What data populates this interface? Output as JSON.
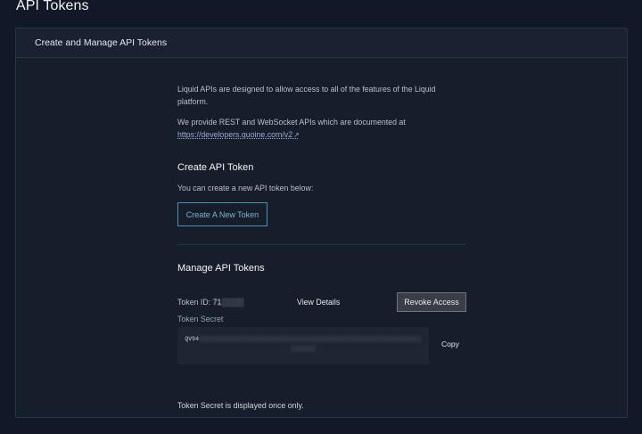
{
  "page": {
    "title": "API Tokens"
  },
  "card": {
    "header": "Create and Manage API Tokens"
  },
  "intro": {
    "line1": "Liquid APIs are designed to allow access to all of the features of the Liquid platform.",
    "line2_prefix": "We provide REST and WebSocket APIs which are documented at ",
    "link_text": "https://developers.quoine.com/v2",
    "link_icon": "external-link-icon"
  },
  "create": {
    "title": "Create API Token",
    "description": "You can create a new API token below:",
    "button_label": "Create A New Token"
  },
  "manage": {
    "title": "Manage API Tokens",
    "token_id_label": "Token ID: ",
    "token_id_value": "71░░░░",
    "view_details_label": "View Details",
    "revoke_label": "Revoke Access",
    "secret_label": "Token Secret",
    "secret_prefix": "QV94",
    "secret_masked": "░░░░░░░░░░░░░░░░░░░░░░░░░░░░░░░░░░░░░░░░░░░░░░░░░░░░░░░░░░░░░░░░░░░░░░░",
    "copy_label": "Copy",
    "secret_note": "Token Secret is displayed once only."
  },
  "colors": {
    "background": "#111827",
    "card": "#161d2b",
    "accent": "#4f8fb1",
    "link": "#9ca9d3"
  }
}
